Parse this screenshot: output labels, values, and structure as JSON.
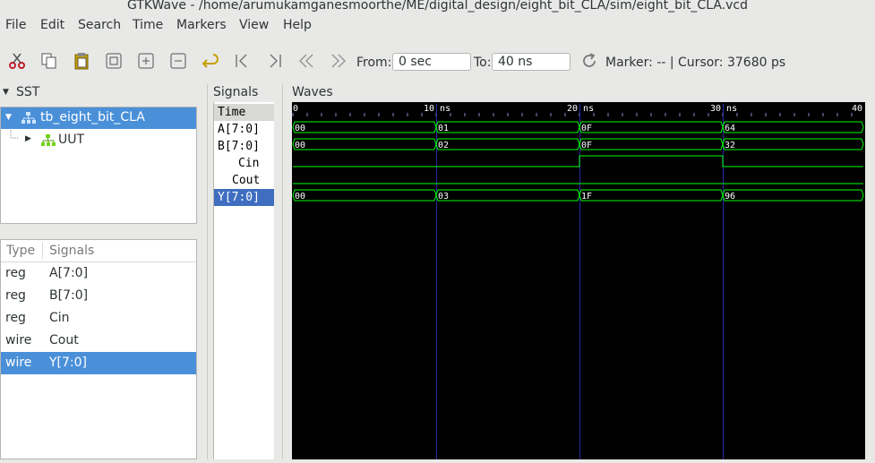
{
  "window": {
    "title": "GTKWave - /home/arumukamganesmoorthe/ME/digital_design/eight_bit_CLA/sim/eight_bit_CLA.vcd"
  },
  "menu": [
    "File",
    "Edit",
    "Search",
    "Time",
    "Markers",
    "View",
    "Help"
  ],
  "toolbar": {
    "from_label": "From:",
    "from_value": "0 sec",
    "to_label": "To:",
    "to_value": "40 ns",
    "status": "Marker: -- | Cursor: 37680 ps"
  },
  "sst": {
    "title": "SST",
    "tree": [
      {
        "label": "tb_eight_bit_CLA"
      },
      {
        "label": "UUT"
      }
    ],
    "columns": [
      "Type",
      "Signals"
    ],
    "signals": [
      {
        "type": "reg",
        "name": "A[7:0]"
      },
      {
        "type": "reg",
        "name": "B[7:0]"
      },
      {
        "type": "reg",
        "name": "Cin"
      },
      {
        "type": "wire",
        "name": "Cout"
      },
      {
        "type": "wire",
        "name": "Y[7:0]"
      }
    ]
  },
  "signals_panel": {
    "title": "Signals",
    "names": [
      "Time",
      "A[7:0]",
      "B[7:0]",
      "Cin",
      "Cout",
      "Y[7:0]"
    ]
  },
  "waves": {
    "title": "Waves",
    "range": [
      0,
      40
    ],
    "ticks": [
      {
        "t": 0,
        "label": "0"
      },
      {
        "t": 10,
        "label": "10 ns"
      },
      {
        "t": 20,
        "label": "20 ns"
      },
      {
        "t": 30,
        "label": "30 ns"
      },
      {
        "t": 40,
        "label": "40"
      }
    ],
    "buses": [
      {
        "name": "A[7:0]",
        "segments": [
          {
            "t": 0,
            "v": "00"
          },
          {
            "t": 10,
            "v": "01"
          },
          {
            "t": 20,
            "v": "0F"
          },
          {
            "t": 30,
            "v": "64"
          }
        ]
      },
      {
        "name": "B[7:0]",
        "segments": [
          {
            "t": 0,
            "v": "00"
          },
          {
            "t": 10,
            "v": "02"
          },
          {
            "t": 20,
            "v": "0F"
          },
          {
            "t": 30,
            "v": "32"
          }
        ]
      },
      {
        "name": "Y[7:0]",
        "segments": [
          {
            "t": 0,
            "v": "00"
          },
          {
            "t": 10,
            "v": "03"
          },
          {
            "t": 20,
            "v": "1F"
          },
          {
            "t": 30,
            "v": "96"
          }
        ]
      }
    ],
    "bits": [
      {
        "name": "Cin",
        "levels": [
          {
            "t": 0,
            "v": 0
          },
          {
            "t": 20,
            "v": 1
          },
          {
            "t": 30,
            "v": 0
          }
        ]
      },
      {
        "name": "Cout",
        "levels": [
          {
            "t": 0,
            "v": 0
          }
        ]
      }
    ],
    "colors": {
      "wave": "#00ff00",
      "grid": "#2a2aa0",
      "text": "#ffffff",
      "background": "#000000"
    }
  }
}
